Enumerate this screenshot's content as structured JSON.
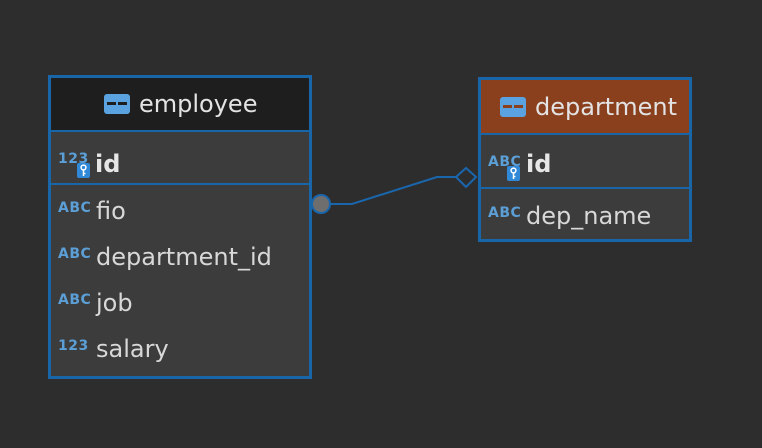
{
  "colors": {
    "background": "#2d2d2d",
    "border": "#1865a8",
    "employee_header": "#1e1e1e",
    "department_header": "#8a3f1d",
    "row_background": "#3c3c3c",
    "type_icon": "#5b9fd6"
  },
  "entities": {
    "employee": {
      "title": "employee",
      "icon": "table-icon",
      "primary_key": {
        "type_badge": "123",
        "name": "id",
        "key_icon": "primary-key-icon"
      },
      "columns": [
        {
          "type_badge": "ABC",
          "name": "fio"
        },
        {
          "type_badge": "ABC",
          "name": "department_id"
        },
        {
          "type_badge": "ABC",
          "name": "job"
        },
        {
          "type_badge": "123",
          "name": "salary"
        }
      ]
    },
    "department": {
      "title": "department",
      "icon": "table-icon",
      "primary_key": {
        "type_badge": "ABC",
        "name": "id",
        "key_icon": "primary-key-icon"
      },
      "columns": [
        {
          "type_badge": "ABC",
          "name": "dep_name"
        }
      ]
    }
  },
  "relationship": {
    "from": "employee",
    "to": "department",
    "source_end": "circle",
    "target_end": "diamond"
  }
}
